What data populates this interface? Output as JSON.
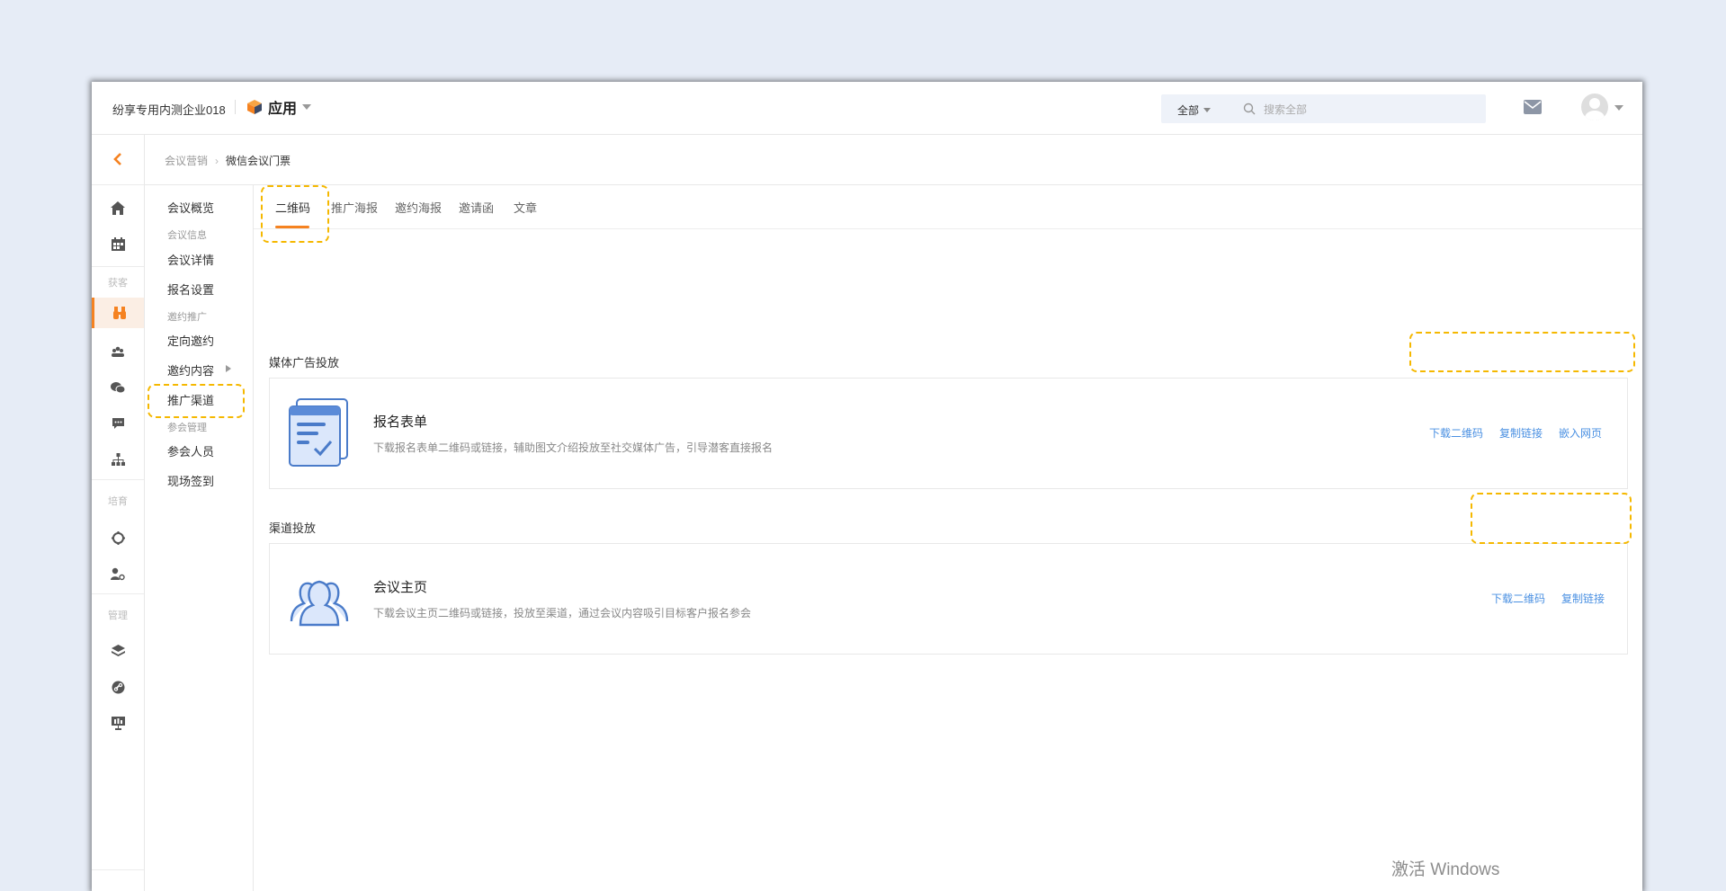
{
  "header": {
    "company": "纷享专用内测企业018",
    "app_label": "应用",
    "search_scope": "全部",
    "search_placeholder": "搜索全部"
  },
  "icon_rail": {
    "groups": [
      "获客",
      "培育",
      "管理"
    ]
  },
  "breadcrumb": {
    "parent": "会议营销",
    "separator": "›",
    "current": "微信会议门票"
  },
  "subnav": {
    "items": [
      {
        "label": "会议概览",
        "type": "item"
      },
      {
        "label": "会议信息",
        "type": "group"
      },
      {
        "label": "会议详情",
        "type": "item"
      },
      {
        "label": "报名设置",
        "type": "item"
      },
      {
        "label": "邀约推广",
        "type": "group"
      },
      {
        "label": "定向邀约",
        "type": "item"
      },
      {
        "label": "邀约内容",
        "type": "item"
      },
      {
        "label": "推广渠道",
        "type": "item"
      },
      {
        "label": "参会管理",
        "type": "group"
      },
      {
        "label": "参会人员",
        "type": "item"
      },
      {
        "label": "现场签到",
        "type": "item"
      }
    ]
  },
  "tabs": [
    "二维码",
    "推广海报",
    "邀约海报",
    "邀请函",
    "文章"
  ],
  "sections": [
    {
      "title": "媒体广告投放",
      "card": {
        "title": "报名表单",
        "desc": "下载报名表单二维码或链接，辅助图文介绍投放至社交媒体广告，引导潜客直接报名",
        "actions": [
          "下载二维码",
          "复制链接",
          "嵌入网页"
        ]
      }
    },
    {
      "title": "渠道投放",
      "card": {
        "title": "会议主页",
        "desc": "下载会议主页二维码或链接，投放至渠道，通过会议内容吸引目标客户报名参会",
        "actions": [
          "下载二维码",
          "复制链接"
        ]
      }
    }
  ],
  "colors": {
    "accent": "#f58220",
    "link": "#4a90e2",
    "highlight": "#f5b800",
    "background": "#e6ecf6"
  },
  "watermark": "激活 Windows"
}
